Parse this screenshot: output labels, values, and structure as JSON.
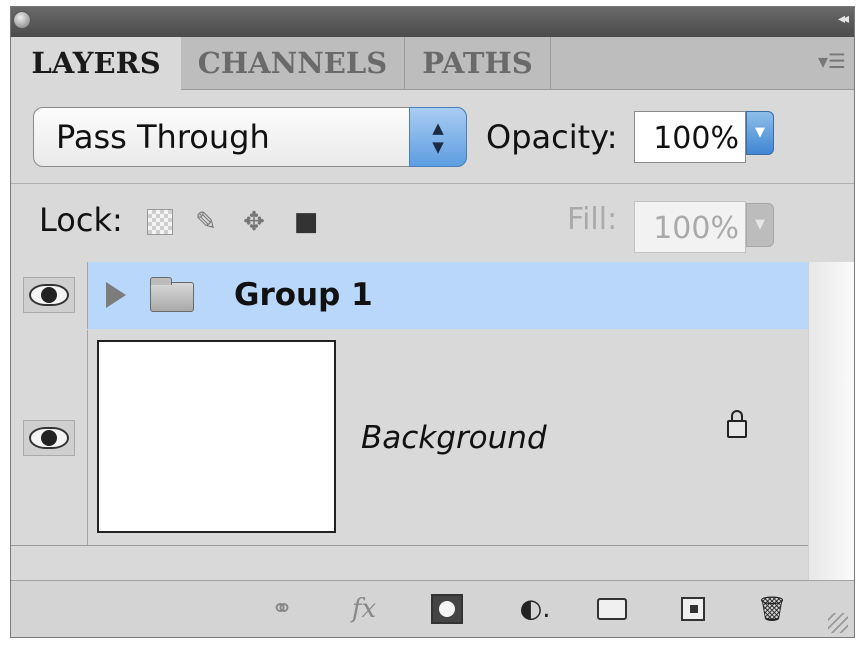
{
  "tabs": [
    {
      "label": "LAYERS",
      "active": true
    },
    {
      "label": "CHANNELS",
      "active": false
    },
    {
      "label": "PATHS",
      "active": false
    }
  ],
  "blend_mode": {
    "value": "Pass Through"
  },
  "opacity": {
    "label": "Opacity:",
    "value": "100%"
  },
  "lock": {
    "label": "Lock:"
  },
  "fill": {
    "label": "Fill:",
    "value": "100%"
  },
  "layers": [
    {
      "name": "Group 1",
      "type": "group",
      "selected": true
    },
    {
      "name": "Background",
      "type": "layer",
      "locked": true
    }
  ],
  "colors": {
    "selected_row": "#b8d7fa",
    "panel_bg": "#d9d9d9",
    "accent": "#5d9de0"
  }
}
